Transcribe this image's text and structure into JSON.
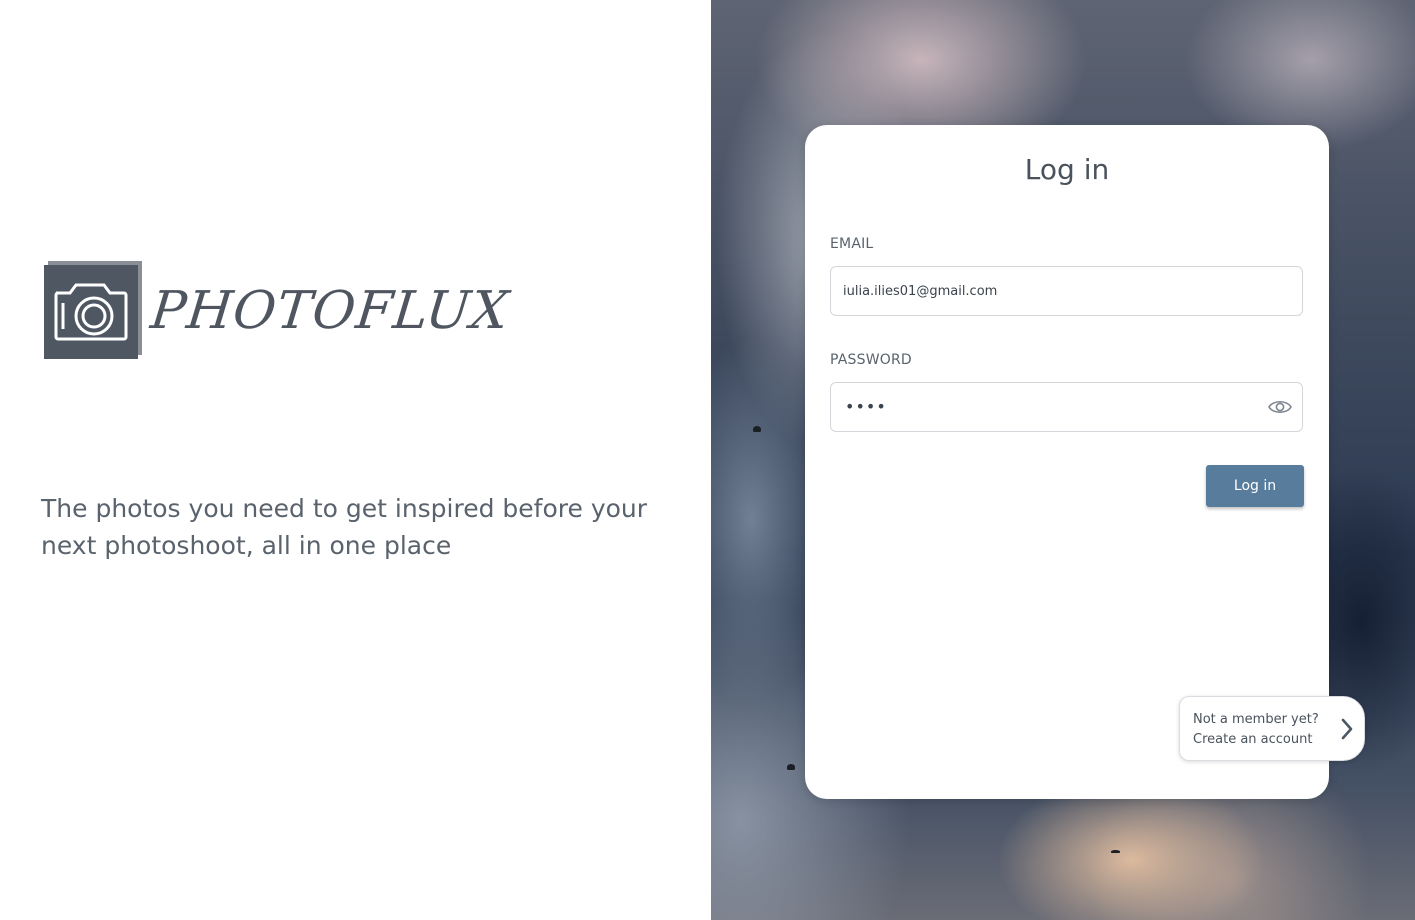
{
  "brand": {
    "name": "PHOTOFLUX",
    "tagline": "The photos you need to get inspired before your next photoshoot, all in one place"
  },
  "login": {
    "title": "Log in",
    "email_label": "EMAIL",
    "email_value": "iulia.ilies01@gmail.com",
    "password_label": "PASSWORD",
    "password_masked": "••••",
    "submit_label": "Log in"
  },
  "signup": {
    "line1": "Not a member yet?",
    "line2": "Create an account"
  },
  "colors": {
    "primary_button": "#587c9c",
    "text": "#4a525c",
    "logo_dark": "#4f5862"
  },
  "icons": {
    "password_toggle": "eye-icon",
    "signup_arrow": "chevron-right-icon",
    "logo": "camera-icon"
  }
}
